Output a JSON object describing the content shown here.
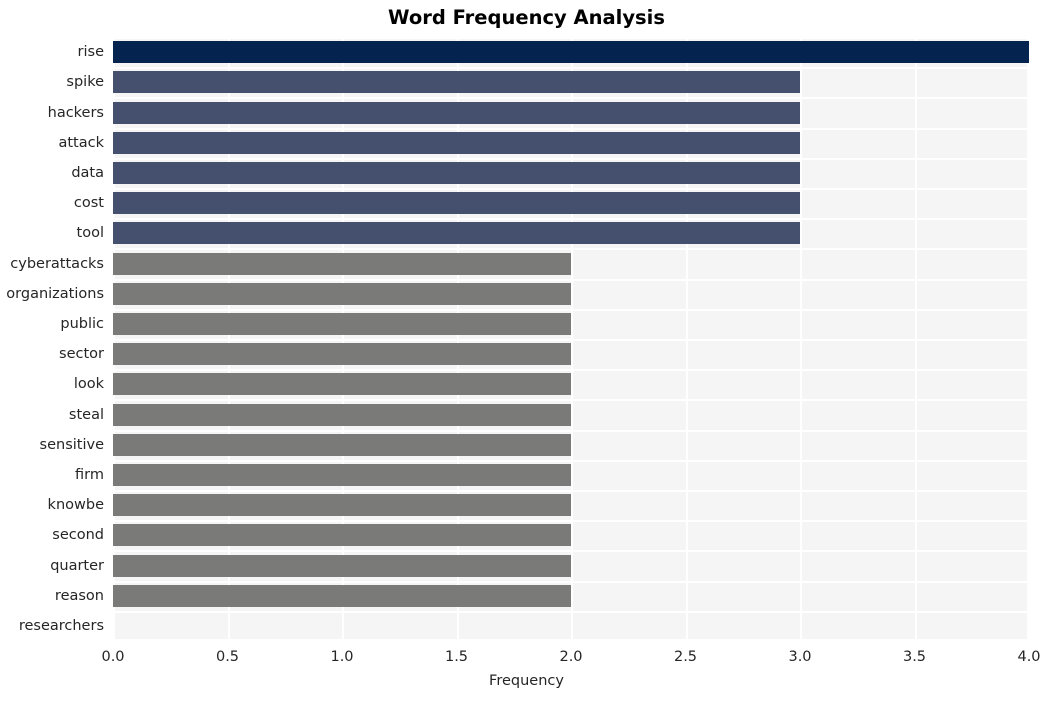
{
  "chart_data": {
    "type": "bar",
    "orientation": "horizontal",
    "title": "Word Frequency Analysis",
    "xlabel": "Frequency",
    "ylabel": "",
    "xlim": [
      0.0,
      4.0
    ],
    "xticks": [
      "0.0",
      "0.5",
      "1.0",
      "1.5",
      "2.0",
      "2.5",
      "3.0",
      "3.5",
      "4.0"
    ],
    "xtick_values": [
      0.0,
      0.5,
      1.0,
      1.5,
      2.0,
      2.5,
      3.0,
      3.5,
      4.0
    ],
    "grid": true,
    "grid_color": "#ffffff",
    "plot_background": "#f5f5f6",
    "legend": null,
    "categories": [
      "rise",
      "spike",
      "hackers",
      "attack",
      "data",
      "cost",
      "tool",
      "cyberattacks",
      "organizations",
      "public",
      "sector",
      "look",
      "steal",
      "sensitive",
      "firm",
      "knowbe",
      "second",
      "quarter",
      "reason",
      "researchers"
    ],
    "values": [
      4,
      3,
      3,
      3,
      3,
      3,
      3,
      2,
      2,
      2,
      2,
      2,
      2,
      2,
      2,
      2,
      2,
      2,
      2
    ],
    "bar_colors": [
      "#04244f",
      "#454f6e",
      "#454f6e",
      "#454f6e",
      "#454f6e",
      "#454f6e",
      "#454f6e",
      "#7a7a78",
      "#7a7a78",
      "#7a7a78",
      "#7a7a78",
      "#7a7a78",
      "#7a7a78",
      "#7a7a78",
      "#7a7a78",
      "#7a7a78",
      "#7a7a78",
      "#7a7a78",
      "#7a7a78"
    ],
    "palette": {
      "highest": "#04244f",
      "mid": "#454f6e",
      "low": "#7a7a78"
    }
  }
}
